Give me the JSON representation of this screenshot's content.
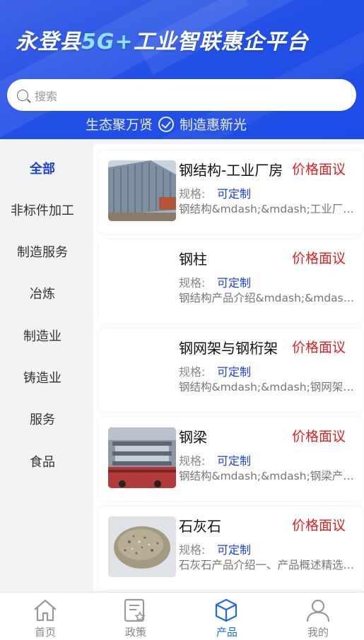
{
  "header": {
    "title_a": "永登县",
    "title_hl": "5G+",
    "title_b": "工业智联惠企平台",
    "search_placeholder": "搜索",
    "slogan_left": "生态聚万贤",
    "slogan_right": "制造惠新光"
  },
  "sidebar": {
    "items": [
      "全部",
      "非标件加工",
      "制造服务",
      "冶炼",
      "制造业",
      "铸造业",
      "服务",
      "食品"
    ],
    "active_index": 0
  },
  "products": [
    {
      "name": "钢结构-工业厂房",
      "price": "价格面议",
      "spec_label": "规格:",
      "spec_value": "可定制",
      "desc": "钢结构&mdash;&mdash;工业厂房产品介绍",
      "thumb": "building"
    },
    {
      "name": "钢柱",
      "price": "价格面议",
      "spec_label": "规格:",
      "spec_value": "可定制",
      "desc": "钢结构产品介绍&mdash;&mdash;钢柱产品",
      "thumb": "blank"
    },
    {
      "name": "钢网架与钢桁架",
      "price": "价格面议",
      "spec_label": "规格:",
      "spec_value": "可定制",
      "desc": "钢结构&mdash;&mdash;钢网架与钢桁架",
      "thumb": "blank"
    },
    {
      "name": "钢梁",
      "price": "价格面议",
      "spec_label": "规格:",
      "spec_value": "可定制",
      "desc": "钢结构&mdash;&mdash;钢梁产品介绍",
      "thumb": "beam"
    },
    {
      "name": "石灰石",
      "price": "价格面议",
      "spec_label": "规格:",
      "spec_value": "可定制",
      "desc": "石灰石产品介绍一、产品概述精选优质",
      "thumb": "stone"
    }
  ],
  "tabbar": {
    "items": [
      {
        "label": "首页",
        "icon": "home-icon"
      },
      {
        "label": "政策",
        "icon": "policy-icon"
      },
      {
        "label": "产品",
        "icon": "cube-icon"
      },
      {
        "label": "我的",
        "icon": "user-icon"
      }
    ],
    "active_index": 2
  },
  "colors": {
    "brand": "#2350e6",
    "accent": "#1a3fe0",
    "price": "#e02020",
    "tab_active": "#1a6fe0"
  }
}
